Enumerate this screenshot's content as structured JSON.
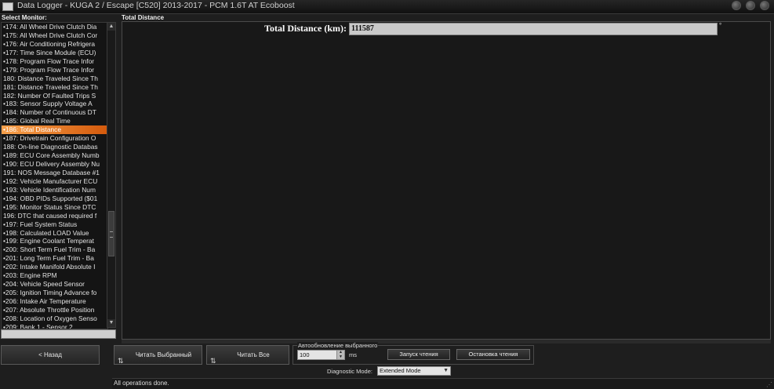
{
  "window": {
    "title": "Data Logger - KUGA 2 / Escape [C520] 2013-2017 - PCM 1.6T AT Ecoboost"
  },
  "monitor_list": {
    "label": "Select Monitor:",
    "items": [
      {
        "label": "•174: All Wheel Drive Clutch Dia",
        "selected": false
      },
      {
        "label": "•175: All Wheel Drive Clutch Cor",
        "selected": false
      },
      {
        "label": "•176: Air Conditioning Refrigera",
        "selected": false
      },
      {
        "label": "•177: Time Since Module (ECU)",
        "selected": false
      },
      {
        "label": "•178: Program Flow Trace Infor",
        "selected": false
      },
      {
        "label": "•179: Program Flow Trace Infor",
        "selected": false
      },
      {
        "label": "180: Distance Traveled Since Th",
        "selected": false
      },
      {
        "label": "181: Distance Traveled Since Th",
        "selected": false
      },
      {
        "label": "182: Number Of Faulted Trips S",
        "selected": false
      },
      {
        "label": "•183: Sensor Supply Voltage A",
        "selected": false
      },
      {
        "label": "•184: Number of Continuous DT",
        "selected": false
      },
      {
        "label": "•185: Global Real Time",
        "selected": false
      },
      {
        "label": "•186: Total Distance",
        "selected": true
      },
      {
        "label": "•187: Drivetrain Configuration O",
        "selected": false
      },
      {
        "label": "188: On-line Diagnostic Databas",
        "selected": false
      },
      {
        "label": "•189: ECU Core Assembly Numb",
        "selected": false
      },
      {
        "label": "•190: ECU Delivery Assembly Nu",
        "selected": false
      },
      {
        "label": "191: NOS Message Database #1",
        "selected": false
      },
      {
        "label": "•192: Vehicle Manufacturer ECU",
        "selected": false
      },
      {
        "label": "•193: Vehicle Identification Num",
        "selected": false
      },
      {
        "label": "•194: OBD PIDs Supported ($01",
        "selected": false
      },
      {
        "label": "•195: Monitor Status Since DTC",
        "selected": false
      },
      {
        "label": "196: DTC that caused required f",
        "selected": false
      },
      {
        "label": "•197: Fuel System Status",
        "selected": false
      },
      {
        "label": "•198: Calculated LOAD Value",
        "selected": false
      },
      {
        "label": "•199: Engine Coolant Temperat",
        "selected": false
      },
      {
        "label": "•200: Short Term Fuel Trim - Ba",
        "selected": false
      },
      {
        "label": "•201: Long Term Fuel Trim - Ba",
        "selected": false
      },
      {
        "label": "•202: Intake Manifold Absolute I",
        "selected": false
      },
      {
        "label": "•203: Engine RPM",
        "selected": false
      },
      {
        "label": "•204: Vehicle Speed Sensor",
        "selected": false
      },
      {
        "label": "•205: Ignition Timing Advance fo",
        "selected": false
      },
      {
        "label": "•206: Intake Air Temperature",
        "selected": false
      },
      {
        "label": "•207: Absolute Throttle Position",
        "selected": false
      },
      {
        "label": "•208: Location of Oxygen Senso",
        "selected": false
      },
      {
        "label": "•209: Bank 1 - Sensor 2",
        "selected": false
      }
    ]
  },
  "main": {
    "label": "Total Distance",
    "reading": {
      "label": "Total Distance (km):",
      "value": "111587",
      "unit": "°"
    }
  },
  "buttons": {
    "back": "< Назад",
    "read_selected": "Читать Выбранный",
    "read_all": "Читать Все",
    "start_reading": "Запуск чтения",
    "stop_reading": "Остановка чтения"
  },
  "auto_refresh": {
    "label": "Автообновление выбранного",
    "interval_value": "100",
    "unit": "ms"
  },
  "diagnostic_mode": {
    "label": "Diagnostic Mode:",
    "selected": "Extended Mode"
  },
  "status": "All operations done."
}
